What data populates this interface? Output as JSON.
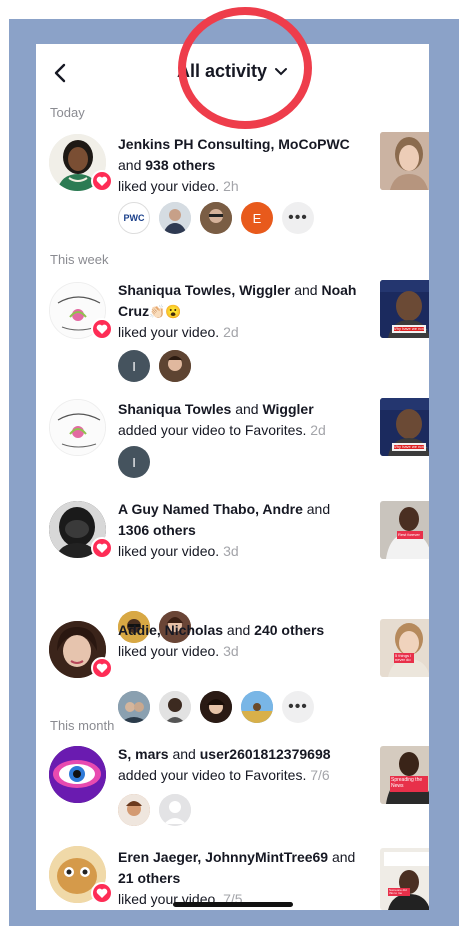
{
  "header": {
    "title": "All activity",
    "back_icon": "chevron-left-icon",
    "dropdown_icon": "chevron-down-icon"
  },
  "sections": {
    "today": "Today",
    "this_week": "This week",
    "this_month": "This month"
  },
  "items": [
    {
      "names": "Jenkins PH Consulting, MoCoPWC",
      "rest": "and",
      "count": "938 others",
      "action": "liked your video.",
      "time": "2h",
      "mini_letters": [
        "PWC",
        "",
        "",
        "E",
        "•••"
      ]
    },
    {
      "names": "Shaniqua Towles, Wiggler",
      "rest": "and",
      "names2": "Noah Cruz",
      "emoji": "👏🏻😮",
      "action": "liked your video.",
      "time": "2d",
      "mini_letters": [
        "I",
        ""
      ]
    },
    {
      "names": "Shaniqua Towles",
      "rest": "and",
      "names2": "Wiggler",
      "action": "added your video to Favorites.",
      "time": "2d",
      "mini_letters": [
        "I"
      ]
    },
    {
      "names": "A Guy Named Thabo, Andre",
      "rest": "and",
      "count": "1306 others",
      "action": "liked your video.",
      "time": "3d"
    },
    {
      "names": "Addie, Nicholas",
      "rest": "and",
      "count": "240 others",
      "action": "liked your video.",
      "time": "3d",
      "mini_letters": [
        "",
        "",
        "",
        "",
        "•••"
      ]
    },
    {
      "names": "S, mars",
      "rest": "and",
      "names2": "user2601812379698",
      "action": "added your video to Favorites.",
      "time": "7/6"
    },
    {
      "names": "Eren Jaeger, JohnnyMintTree69",
      "rest": "and",
      "count": "21 others",
      "action": "liked your video.",
      "time": "7/5"
    }
  ],
  "thumbs": {
    "t2": "Why have we not…",
    "t3": "Why have we not…",
    "t4": "Rest forever",
    "t5": "5 things I never do",
    "t6": "Spreading the News",
    "t7": "Someone did this to me"
  },
  "colors": {
    "accent": "#fe2c55",
    "frame": "#8ba2c8",
    "annotation": "#ee3d4b"
  }
}
